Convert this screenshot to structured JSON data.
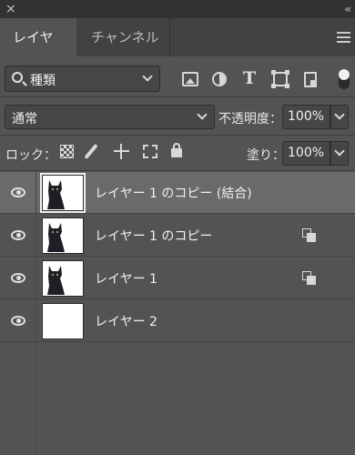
{
  "panel": {
    "close_glyph": "×",
    "collapse_glyph": "‹‹",
    "tabs": [
      {
        "label": "レイヤー",
        "active": true
      },
      {
        "label": "チャンネル",
        "active": false
      }
    ]
  },
  "filter": {
    "kind_label": "種類",
    "icons": [
      "image-filter-icon",
      "adjustment-filter-icon",
      "type-filter-icon",
      "shape-filter-icon",
      "smart-object-filter-icon"
    ],
    "text_icon_glyph": "T"
  },
  "blend": {
    "mode": "通常",
    "opacity_label": "不透明度：",
    "opacity_value": "100%"
  },
  "lock": {
    "label": "ロック：",
    "fill_label": "塗り：",
    "fill_value": "100%"
  },
  "layers": [
    {
      "name": "レイヤー 1 のコピー (結合)",
      "visible": true,
      "selected": true,
      "has_cat": true,
      "smart": false
    },
    {
      "name": "レイヤー 1 のコピー",
      "visible": true,
      "selected": false,
      "has_cat": true,
      "smart": true
    },
    {
      "name": "レイヤー 1",
      "visible": true,
      "selected": false,
      "has_cat": true,
      "smart": true
    },
    {
      "name": "レイヤー 2",
      "visible": true,
      "selected": false,
      "has_cat": false,
      "smart": false
    }
  ],
  "colors": {
    "panel_bg": "#535353",
    "tab_bar_bg": "#424242",
    "selected_row": "#6a6a6a"
  }
}
